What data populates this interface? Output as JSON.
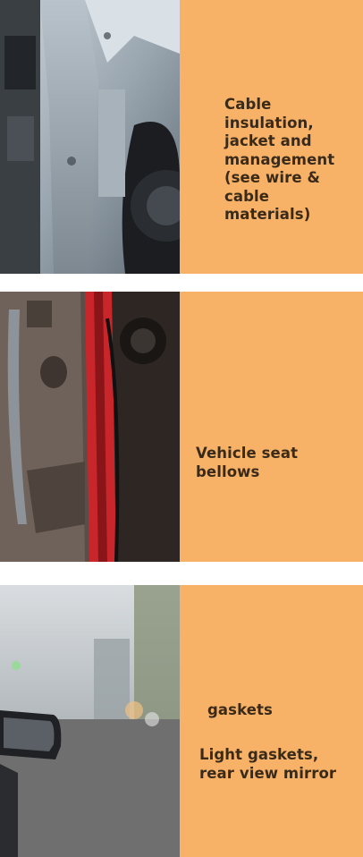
{
  "rows": [
    {
      "photo_subject": "car-body-frame-photo",
      "caption_lines": [
        "Cable",
        "insulation,",
        "jacket and",
        "management",
        "(see wire &",
        "cable",
        "materials)"
      ]
    },
    {
      "photo_subject": "red-car-door-photo",
      "caption_lines": [
        "Vehicle seat",
        "bellows"
      ]
    },
    {
      "photo_subject": "side-mirror-street-photo",
      "heading": "gaskets",
      "caption_lines": [
        "Light gaskets,",
        "rear view mirror"
      ]
    }
  ],
  "colors": {
    "panel": "#f8b267",
    "text": "#3a2a1a"
  }
}
